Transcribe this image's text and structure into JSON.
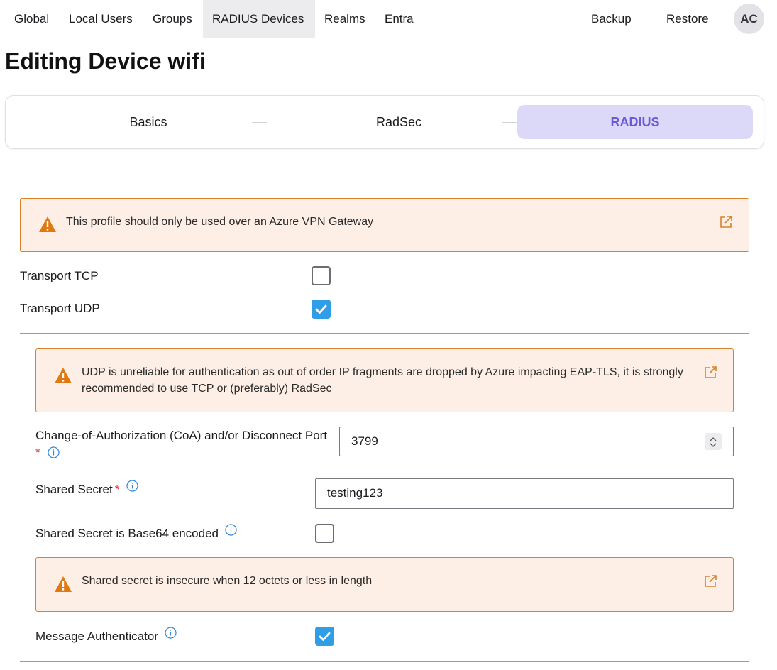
{
  "nav": {
    "items": [
      "Global",
      "Local Users",
      "Groups",
      "RADIUS Devices",
      "Realms",
      "Entra"
    ],
    "backup": "Backup",
    "restore": "Restore",
    "avatar": "AC"
  },
  "page": {
    "title": "Editing Device wifi"
  },
  "stepper": {
    "steps": [
      "Basics",
      "RadSec",
      "RADIUS"
    ],
    "active": "RADIUS"
  },
  "alerts": {
    "azure": "This profile should only be used over an Azure VPN Gateway",
    "udp": "UDP is unreliable for authentication as out of order IP fragments are dropped by Azure impacting EAP-TLS, it is strongly recommended to use TCP or (preferably) RadSec",
    "secret": "Shared secret is insecure when 12 octets or less in length"
  },
  "form": {
    "transport_tcp": {
      "label": "Transport TCP",
      "checked": false
    },
    "transport_udp": {
      "label": "Transport UDP",
      "checked": true
    },
    "coa_port": {
      "label": "Change-of-Authorization (CoA) and/or Disconnect Port",
      "required": "*",
      "value": "3799"
    },
    "shared_secret": {
      "label": "Shared Secret",
      "required": "*",
      "value": "testing123"
    },
    "shared_secret_b64": {
      "label": "Shared Secret is Base64 encoded",
      "checked": false
    },
    "message_auth": {
      "label": "Message Authenticator",
      "checked": true
    }
  },
  "colors": {
    "accent": "#6a5ad8",
    "active_step_bg": "#dcd8f7",
    "checkbox_on": "#2f9ee6",
    "warning_border": "#d9822b",
    "warning_bg": "#fdeee6",
    "info_icon": "#2f86d6"
  }
}
